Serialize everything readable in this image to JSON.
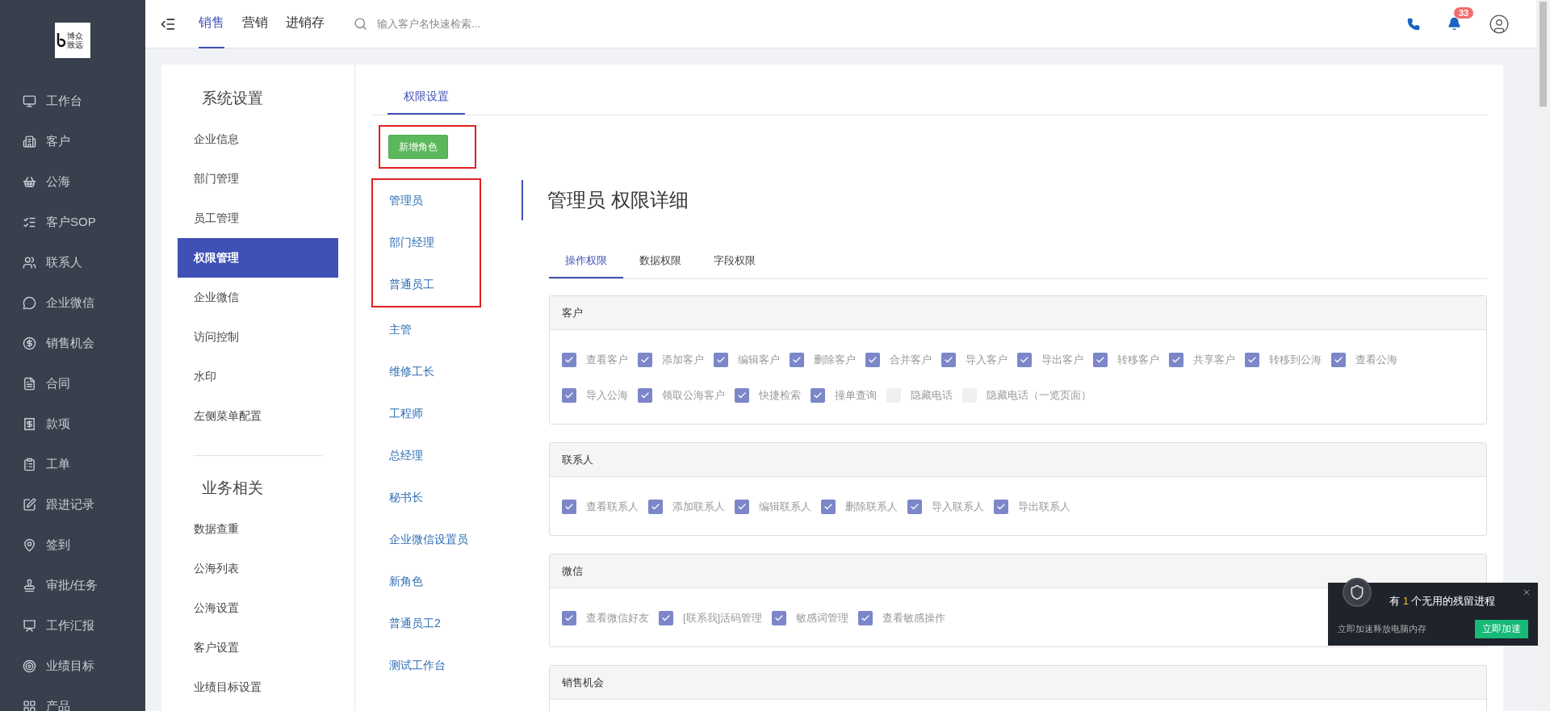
{
  "logo": {
    "text": "博众致远"
  },
  "sidebar": {
    "items": [
      {
        "label": "工作台"
      },
      {
        "label": "客户"
      },
      {
        "label": "公海"
      },
      {
        "label": "客户SOP"
      },
      {
        "label": "联系人"
      },
      {
        "label": "企业微信"
      },
      {
        "label": "销售机会"
      },
      {
        "label": "合同"
      },
      {
        "label": "款项"
      },
      {
        "label": "工单"
      },
      {
        "label": "跟进记录"
      },
      {
        "label": "签到"
      },
      {
        "label": "审批/任务"
      },
      {
        "label": "工作汇报"
      },
      {
        "label": "业绩目标"
      },
      {
        "label": "产品"
      }
    ]
  },
  "topbar": {
    "tabs": [
      {
        "label": "销售",
        "selected": true
      },
      {
        "label": "营销",
        "selected": false
      },
      {
        "label": "进销存",
        "selected": false
      }
    ],
    "search": {
      "placeholder": "输入客户名快速检索..."
    },
    "notification_count": "33"
  },
  "settings_menu": {
    "groups": [
      {
        "title": "系统设置",
        "items": [
          {
            "label": "企业信息",
            "selected": false
          },
          {
            "label": "部门管理",
            "selected": false
          },
          {
            "label": "员工管理",
            "selected": false
          },
          {
            "label": "权限管理",
            "selected": true
          },
          {
            "label": "企业微信",
            "selected": false
          },
          {
            "label": "访问控制",
            "selected": false
          },
          {
            "label": "水印",
            "selected": false
          },
          {
            "label": "左侧菜单配置",
            "selected": false
          }
        ]
      },
      {
        "title": "业务相关",
        "items": [
          {
            "label": "数据查重",
            "selected": false
          },
          {
            "label": "公海列表",
            "selected": false
          },
          {
            "label": "公海设置",
            "selected": false
          },
          {
            "label": "客户设置",
            "selected": false
          },
          {
            "label": "业绩目标设置",
            "selected": false
          }
        ]
      }
    ]
  },
  "panel_tab": "权限设置",
  "add_role_button": "新增角色",
  "roles": [
    {
      "label": "管理员",
      "highlighted": true
    },
    {
      "label": "部门经理",
      "highlighted": true
    },
    {
      "label": "普通员工",
      "highlighted": true
    },
    {
      "label": "主管",
      "highlighted": false
    },
    {
      "label": "维修工长",
      "highlighted": false
    },
    {
      "label": "工程师",
      "highlighted": false
    },
    {
      "label": "总经理",
      "highlighted": false
    },
    {
      "label": "秘书长",
      "highlighted": false
    },
    {
      "label": "企业微信设置员",
      "highlighted": false
    },
    {
      "label": "新角色",
      "highlighted": false
    },
    {
      "label": "普通员工2",
      "highlighted": false
    },
    {
      "label": "测试工作台",
      "highlighted": false
    }
  ],
  "detail": {
    "title": "管理员 权限详细",
    "tabs": [
      {
        "label": "操作权限",
        "selected": true
      },
      {
        "label": "数据权限",
        "selected": false
      },
      {
        "label": "字段权限",
        "selected": false
      }
    ],
    "sections": [
      {
        "title": "客户",
        "permissions": [
          {
            "label": "查看客户",
            "checked": true
          },
          {
            "label": "添加客户",
            "checked": true
          },
          {
            "label": "编辑客户",
            "checked": true
          },
          {
            "label": "删除客户",
            "checked": true
          },
          {
            "label": "合并客户",
            "checked": true
          },
          {
            "label": "导入客户",
            "checked": true
          },
          {
            "label": "导出客户",
            "checked": true
          },
          {
            "label": "转移客户",
            "checked": true
          },
          {
            "label": "共享客户",
            "checked": true
          },
          {
            "label": "转移到公海",
            "checked": true
          },
          {
            "label": "查看公海",
            "checked": true
          },
          {
            "label": "导入公海",
            "checked": true
          },
          {
            "label": "领取公海客户",
            "checked": true
          },
          {
            "label": "快捷检索",
            "checked": true
          },
          {
            "label": "撞单查询",
            "checked": true
          },
          {
            "label": "隐藏电话",
            "checked": false
          },
          {
            "label": "隐藏电话（一览页面）",
            "checked": false
          }
        ]
      },
      {
        "title": "联系人",
        "permissions": [
          {
            "label": "查看联系人",
            "checked": true
          },
          {
            "label": "添加联系人",
            "checked": true
          },
          {
            "label": "编辑联系人",
            "checked": true
          },
          {
            "label": "删除联系人",
            "checked": true
          },
          {
            "label": "导入联系人",
            "checked": true
          },
          {
            "label": "导出联系人",
            "checked": true
          }
        ]
      },
      {
        "title": "微信",
        "permissions": [
          {
            "label": "查看微信好友",
            "checked": true
          },
          {
            "label": "[联系我]活码管理",
            "checked": true
          },
          {
            "label": "敏感词管理",
            "checked": true
          },
          {
            "label": "查看敏感操作",
            "checked": true
          }
        ]
      },
      {
        "title": "销售机会"
      }
    ]
  },
  "toast": {
    "prefix": "有",
    "count": "1",
    "suffix": "个无用的残留进程",
    "message": "立即加速释放电脑内存",
    "button": "立即加速"
  }
}
